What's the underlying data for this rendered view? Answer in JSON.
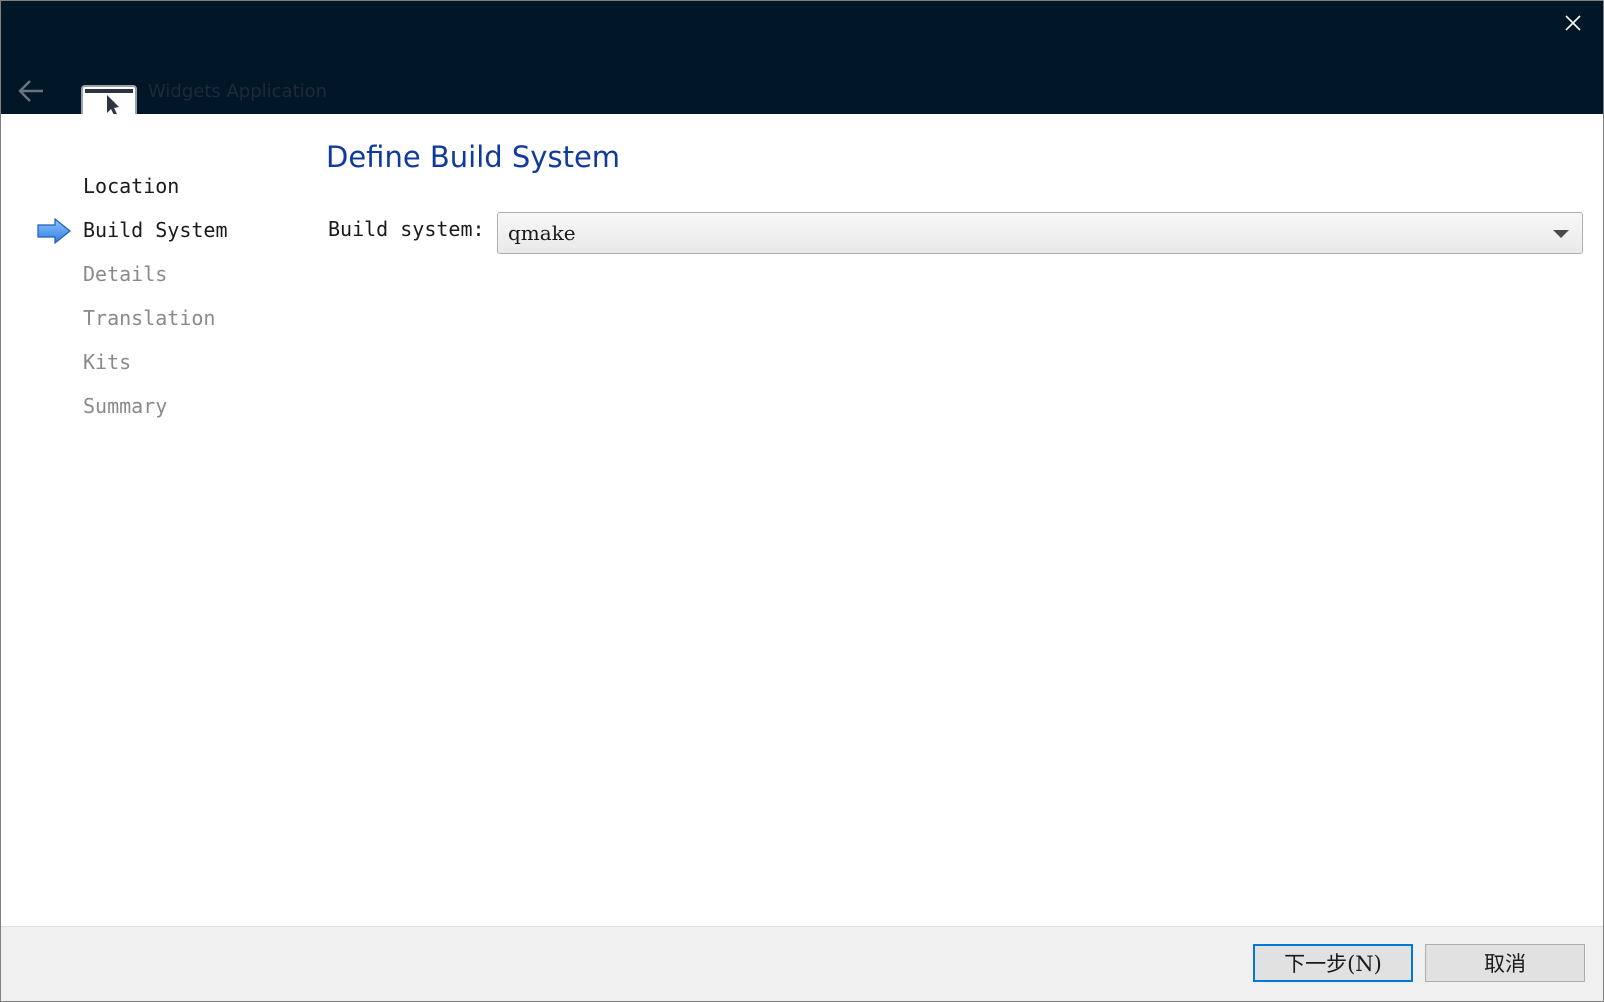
{
  "window": {
    "title": "Widgets Application",
    "icons": {
      "close": "close-icon",
      "back": "back-arrow-icon",
      "app": "widgets-app-icon"
    },
    "colors": {
      "titlebar": "#011627",
      "accent": "#103a9c"
    }
  },
  "steps": {
    "items": [
      {
        "label": "Location",
        "state": "done"
      },
      {
        "label": "Build System",
        "state": "current"
      },
      {
        "label": "Details",
        "state": "pending"
      },
      {
        "label": "Translation",
        "state": "pending"
      },
      {
        "label": "Kits",
        "state": "pending"
      },
      {
        "label": "Summary",
        "state": "pending"
      }
    ],
    "current_indicator_icon": "arrow-right-icon"
  },
  "page": {
    "title": "Define Build System",
    "build_system_label": "Build system:",
    "build_system_value": "qmake"
  },
  "footer": {
    "next_label": "下一步(N)",
    "cancel_label": "取消"
  }
}
